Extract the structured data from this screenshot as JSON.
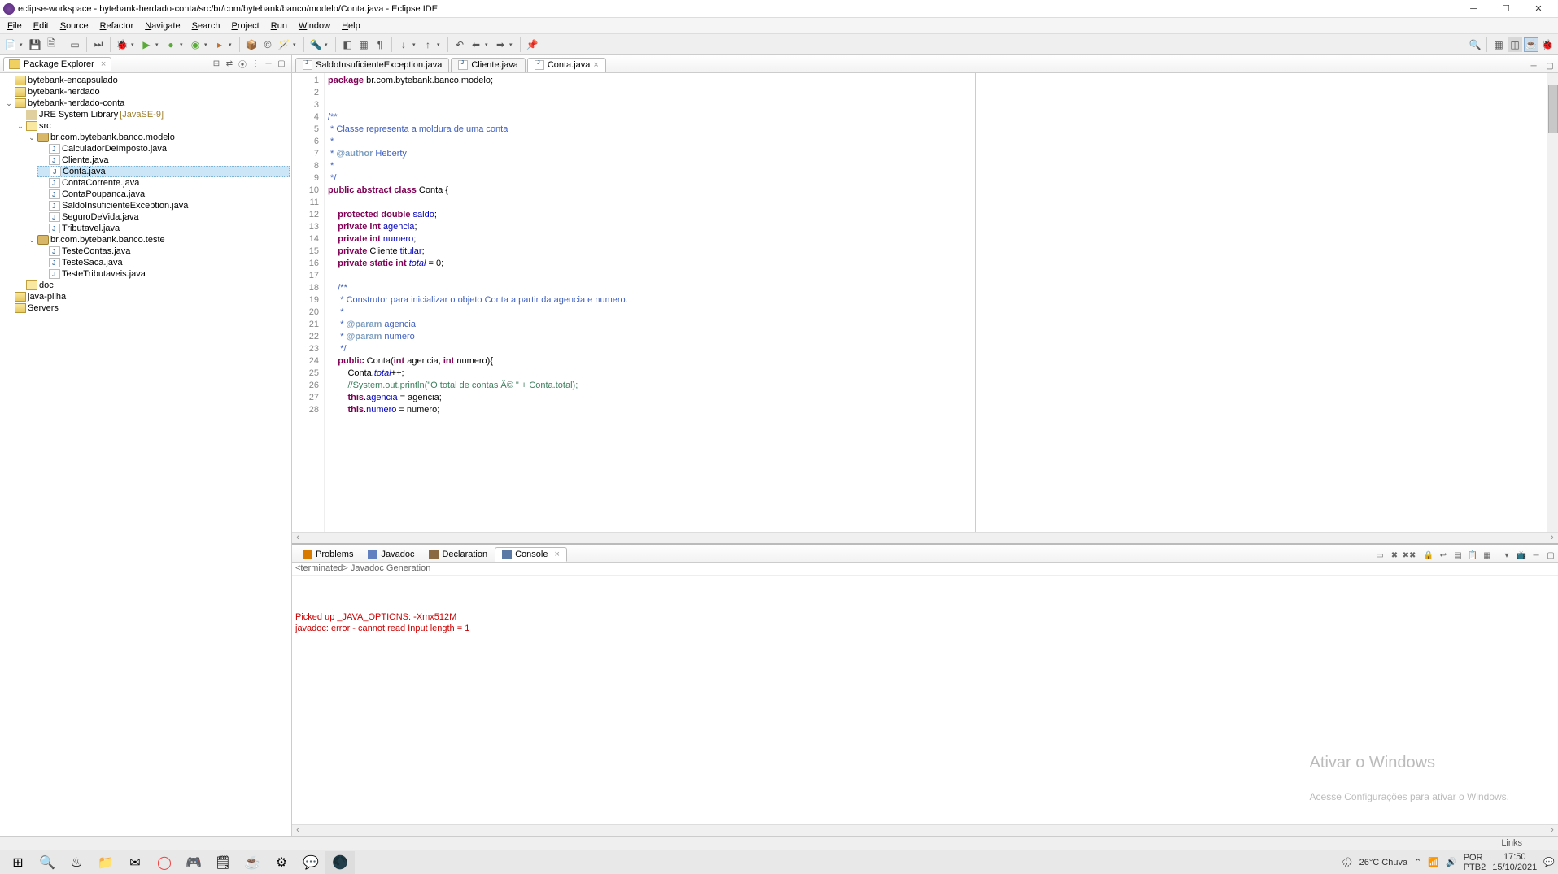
{
  "window": {
    "title": "eclipse-workspace - bytebank-herdado-conta/src/br/com/bytebank/banco/modelo/Conta.java - Eclipse IDE"
  },
  "menu": {
    "items": [
      "File",
      "Edit",
      "Source",
      "Refactor",
      "Navigate",
      "Search",
      "Project",
      "Run",
      "Window",
      "Help"
    ]
  },
  "packageExplorer": {
    "title": "Package Explorer",
    "tree": [
      {
        "label": "bytebank-encapsulado",
        "type": "proj",
        "expanded": false
      },
      {
        "label": "bytebank-herdado",
        "type": "proj",
        "expanded": false
      },
      {
        "label": "bytebank-herdado-conta",
        "type": "proj",
        "expanded": true,
        "children": [
          {
            "label": "JRE System Library",
            "decor": "[JavaSE-9]",
            "type": "lib",
            "expanded": false
          },
          {
            "label": "src",
            "type": "folder",
            "expanded": true,
            "children": [
              {
                "label": "br.com.bytebank.banco.modelo",
                "type": "pkg",
                "expanded": true,
                "children": [
                  {
                    "label": "CalculadorDeImposto.java",
                    "type": "java"
                  },
                  {
                    "label": "Cliente.java",
                    "type": "java"
                  },
                  {
                    "label": "Conta.java",
                    "type": "java",
                    "selected": true
                  },
                  {
                    "label": "ContaCorrente.java",
                    "type": "java"
                  },
                  {
                    "label": "ContaPoupanca.java",
                    "type": "java"
                  },
                  {
                    "label": "SaldoInsuficienteException.java",
                    "type": "java"
                  },
                  {
                    "label": "SeguroDeVida.java",
                    "type": "java"
                  },
                  {
                    "label": "Tributavel.java",
                    "type": "java"
                  }
                ]
              },
              {
                "label": "br.com.bytebank.banco.teste",
                "type": "pkg",
                "expanded": true,
                "children": [
                  {
                    "label": "TesteContas.java",
                    "type": "java"
                  },
                  {
                    "label": "TesteSaca.java",
                    "type": "java"
                  },
                  {
                    "label": "TesteTributaveis.java",
                    "type": "java"
                  }
                ]
              }
            ]
          },
          {
            "label": "doc",
            "type": "folder",
            "expanded": false
          }
        ]
      },
      {
        "label": "java-pilha",
        "type": "proj",
        "expanded": false
      },
      {
        "label": "Servers",
        "type": "proj",
        "expanded": false
      }
    ]
  },
  "editor": {
    "tabs": [
      {
        "label": "SaldoInsuficienteException.java",
        "active": false
      },
      {
        "label": "Cliente.java",
        "active": false
      },
      {
        "label": "Conta.java",
        "active": true
      }
    ],
    "lines": [
      {
        "n": 1,
        "html": "<span class='kw'>package</span> br.com.bytebank.banco.modelo;"
      },
      {
        "n": 2,
        "html": ""
      },
      {
        "n": 3,
        "html": ""
      },
      {
        "n": 4,
        "html": "<span class='jd'>/**</span>",
        "fold": true
      },
      {
        "n": 5,
        "html": "<span class='jd'> * Classe representa a moldura de uma conta</span>"
      },
      {
        "n": 6,
        "html": "<span class='jd'> *</span>"
      },
      {
        "n": 7,
        "html": "<span class='jd'> * </span><span class='jdt'>@author</span><span class='jd'> Heberty</span>"
      },
      {
        "n": 8,
        "html": "<span class='jd'> *</span>"
      },
      {
        "n": 9,
        "html": "<span class='jd'> */</span>"
      },
      {
        "n": 10,
        "html": "<span class='kw'>public</span> <span class='kw'>abstract</span> <span class='kw'>class</span> Conta {",
        "fold": true
      },
      {
        "n": 11,
        "html": ""
      },
      {
        "n": 12,
        "html": "    <span class='kw'>protected</span> <span class='kw'>double</span> <span class='fld'>saldo</span>;"
      },
      {
        "n": 13,
        "html": "    <span class='kw'>private</span> <span class='kw'>int</span> <span class='fld'>agencia</span>;"
      },
      {
        "n": 14,
        "html": "    <span class='kw'>private</span> <span class='kw'>int</span> <span class='fld'>numero</span>;"
      },
      {
        "n": 15,
        "html": "    <span class='kw'>private</span> Cliente <span class='fld'>titular</span>;"
      },
      {
        "n": 16,
        "html": "    <span class='kw'>private</span> <span class='kw'>static</span> <span class='kw'>int</span> <span class='fldst'>total</span> = 0;"
      },
      {
        "n": 17,
        "html": ""
      },
      {
        "n": 18,
        "html": "    <span class='jd'>/**</span>",
        "fold": true
      },
      {
        "n": 19,
        "html": "<span class='jd'>     * Construtor para inicializar o objeto Conta a partir da agencia e numero.</span>"
      },
      {
        "n": 20,
        "html": "<span class='jd'>     *</span>"
      },
      {
        "n": 21,
        "html": "<span class='jd'>     * </span><span class='jdt'>@param</span><span class='jd'> agencia</span>"
      },
      {
        "n": 22,
        "html": "<span class='jd'>     * </span><span class='jdt'>@param</span><span class='jd'> numero</span>"
      },
      {
        "n": 23,
        "html": "<span class='jd'>     */</span>"
      },
      {
        "n": 24,
        "html": "    <span class='kw'>public</span> Conta(<span class='kw'>int</span> agencia, <span class='kw'>int</span> numero){",
        "fold": true
      },
      {
        "n": 25,
        "html": "        Conta.<span class='fldst'>total</span>++;"
      },
      {
        "n": 26,
        "html": "        <span class='cm'>//System.out.println(\"O total de contas Ã© \" + Conta.total);</span>"
      },
      {
        "n": 27,
        "html": "        <span class='kw'>this</span>.<span class='fld'>agencia</span> = agencia;"
      },
      {
        "n": 28,
        "html": "        <span class='kw'>this</span>.<span class='fld'>numero</span> = numero;"
      }
    ]
  },
  "bottom": {
    "tabs": [
      {
        "label": "Problems",
        "icon": "#d97a00"
      },
      {
        "label": "Javadoc",
        "icon": "#6080c0"
      },
      {
        "label": "Declaration",
        "icon": "#8a6a40"
      },
      {
        "label": "Console",
        "icon": "#5a7aa5",
        "active": true
      }
    ],
    "consoleHeader": "<terminated> Javadoc Generation",
    "consoleLines": [
      "Picked up _JAVA_OPTIONS: -Xmx512M",
      "javadoc: error - cannot read Input length = 1"
    ]
  },
  "watermark": {
    "line1": "Ativar o Windows",
    "line2": "Acesse Configurações para ativar o Windows."
  },
  "statusbar": {
    "links": "Links"
  },
  "taskbar": {
    "weather": "26°C  Chuva",
    "lang1": "POR",
    "lang2": "PTB2",
    "time": "17:50",
    "date": "15/10/2021"
  }
}
